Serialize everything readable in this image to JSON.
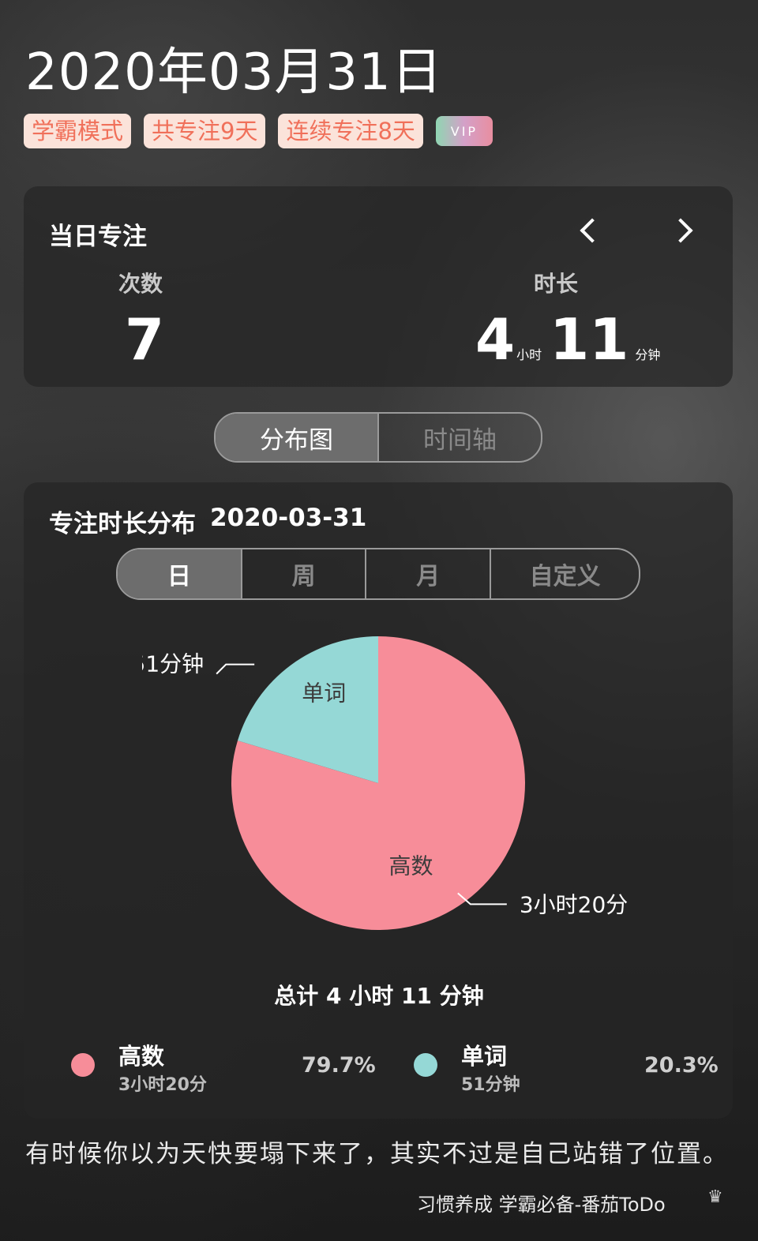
{
  "header": {
    "date_title": "2020年03月31日",
    "tags": [
      "学霸模式",
      "共专注9天",
      "连续专注8天"
    ],
    "vip_badge": "VIP"
  },
  "daily_focus": {
    "title": "当日专注",
    "count_label": "次数",
    "count_value": "7",
    "duration_label": "时长",
    "hours_value": "4",
    "hours_unit": "小时",
    "minutes_value": "11",
    "minutes_unit": "分钟"
  },
  "view_switch": {
    "options": [
      "分布图",
      "时间轴"
    ],
    "selected": "分布图"
  },
  "distribution": {
    "title": "专注时长分布",
    "date": "2020-03-31",
    "range_tabs": [
      "日",
      "周",
      "月",
      "自定义"
    ],
    "selected_range": "日",
    "total_text": "总计 4 小时 11 分钟"
  },
  "chart_data": {
    "type": "pie",
    "slices": [
      {
        "name": "高数",
        "value_text": "3小时20分",
        "minutes": 200,
        "percent": 79.7,
        "color": "#f78d99",
        "legend_sub": "3小时20分",
        "legend_pct": "79.7%"
      },
      {
        "name": "单词",
        "value_text": "51分钟",
        "minutes": 51,
        "percent": 20.3,
        "color": "#95d8d6",
        "legend_sub": "51分钟",
        "legend_pct": "20.3%"
      }
    ]
  },
  "quote": "有时候你以为天快要塌下来了，其实不过是自己站错了位置。",
  "footer": "习惯养成 学霸必备-番茄ToDo",
  "colors": {
    "tag_bg": "#fbe3da",
    "tag_text": "#f0705a",
    "pink": "#f78d99",
    "teal": "#95d8d6"
  }
}
